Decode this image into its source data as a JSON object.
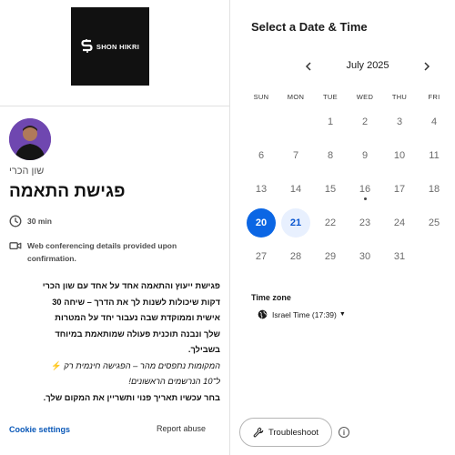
{
  "left": {
    "logo_text": "SHON HIKRI",
    "host_name": "שון הכרי",
    "event_title": "פגישת התאמה",
    "duration": "30 min",
    "conferencing": "Web conferencing details provided upon confirmation.",
    "description": {
      "line1": "פגישת ייעוץ והתאמה אחד על אחד עם שון הכרי",
      "line2": "דקות שיכולות לשנות לך את הדרך – שיחה 30",
      "line3": "אישית וממוקדת שבה נעבור יחד על המטרות",
      "line4": "שלך ונבנה תוכנית פעולה שמותאמת במיוחד",
      "line5": "בשבילך.",
      "promo1": "המקומות נתפסים מהר – הפגישה חינמית רק",
      "promo2": "ל־10 הנרשמים הראשונים!",
      "line6": "בחר עכשיו תאריך פנוי ותשריין את המקום שלך."
    },
    "footer": {
      "cookie_settings": "Cookie settings",
      "report_abuse": "Report abuse"
    }
  },
  "right": {
    "title": "Select a Date & Time",
    "month": "July 2025",
    "weekdays": [
      "SUN",
      "MON",
      "TUE",
      "WED",
      "THU",
      "FRI"
    ],
    "days": [
      [
        "",
        "",
        "1",
        "2",
        "3",
        "4"
      ],
      [
        "6",
        "7",
        "8",
        "9",
        "10",
        "11"
      ],
      [
        "13",
        "14",
        "15",
        "16",
        "17",
        "18"
      ],
      [
        "20",
        "21",
        "22",
        "23",
        "24",
        "25"
      ],
      [
        "27",
        "28",
        "29",
        "30",
        "31",
        ""
      ]
    ],
    "selected_day": "20",
    "available_days": [
      "21"
    ],
    "today_day": "16",
    "timezone_label": "Time zone",
    "timezone_value": "Israel Time (17:39)",
    "troubleshoot": "Troubleshoot",
    "info_glyph": "i"
  },
  "colors": {
    "accent": "#0b66e4",
    "available_bg": "#e8f0fe",
    "link": "#0a58b8"
  }
}
